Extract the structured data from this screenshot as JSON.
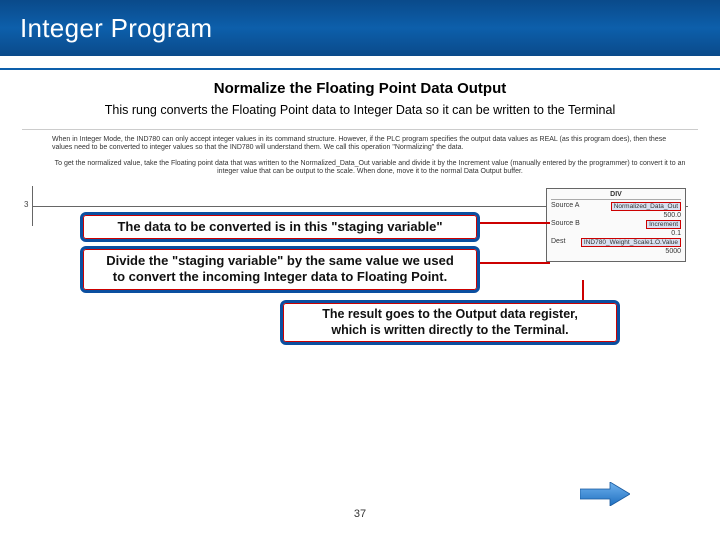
{
  "header": {
    "title": "Integer Program"
  },
  "section": {
    "title": "Normalize the Floating Point Data Output",
    "desc": "This rung converts the Floating Point data to Integer Data so it can be written to the Terminal"
  },
  "diagram": {
    "tiny1": "When in Integer Mode, the IND780 can only accept integer values in its command structure. However, if the PLC program specifies the output data values as REAL (as this program does), then these values need to be converted to integer values so that the IND780 will understand them. We call this operation \"Normalizing\" the data.",
    "tiny2": "To get the normalized value, take the Floating point data that was written to the Normalized_Data_Out variable and divide it by the Increment value (manually entered by the programmer) to convert it to an integer value that can be output to the scale. When done, move it to the normal Data Output buffer.",
    "rung": "3",
    "div": {
      "hd": "DIV",
      "label_sourceA": "Source A",
      "val_sourceA": "Normalized_Data_Out",
      "val_sourceA2": "500.0",
      "label_sourceB": "Source B",
      "val_sourceB": "Increment",
      "val_sourceB2": "0.1",
      "label_dest": "Dest",
      "val_dest": "IND780_Weight_Scale1.O.Value",
      "val_dest2": "5000"
    }
  },
  "callouts": {
    "c1": "The data to be converted is in this \"staging variable\"",
    "c2a": "Divide the \"staging variable\" by the same value we used",
    "c2b": "to convert the incoming Integer data to Floating Point.",
    "c3a": "The result goes to the Output data register,",
    "c3b": "which is written directly to the Terminal."
  },
  "nav": {
    "page": "37",
    "next_icon": "arrow-right-icon"
  }
}
